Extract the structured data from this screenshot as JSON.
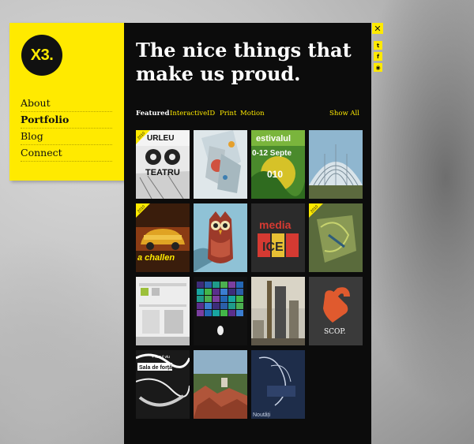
{
  "brand": {
    "logo_text": "X3."
  },
  "nav": {
    "items": [
      {
        "label": "About"
      },
      {
        "label": "Portfolio"
      },
      {
        "label": "Blog"
      },
      {
        "label": "Connect"
      }
    ]
  },
  "main": {
    "title_line1": "The nice things that",
    "title_line2": "make us proud.",
    "filters": [
      {
        "label": "Featured"
      },
      {
        "label": "Interactive"
      },
      {
        "label": "ID"
      },
      {
        "label": "Print"
      },
      {
        "label": "Motion"
      }
    ],
    "show_all_label": "Show All"
  },
  "tiles": {
    "t1": {
      "text_top": "URLEU",
      "text_bottom": "TEATRU",
      "ribbon": "2010"
    },
    "t3": {
      "text": "estivalul",
      "text2": "0-12 Septe",
      "text3": "010"
    },
    "t5": {
      "ribbon": "2010",
      "text": "a challen"
    },
    "t7": {
      "text1": "media",
      "text2": "ICE"
    },
    "t8": {
      "ribbon": "2010"
    },
    "t12": {
      "text": "SCOP."
    },
    "t13": {
      "text1": "Sala de forță",
      "text2": "+ tonul viu"
    },
    "t15": {
      "text1": "Noutăți"
    }
  },
  "social": {
    "close_icon": "close-icon",
    "icons": [
      "twitter-icon",
      "facebook-icon",
      "rss-icon"
    ]
  },
  "colors": {
    "accent": "#ffea00",
    "panel": "#0c0c0c"
  }
}
